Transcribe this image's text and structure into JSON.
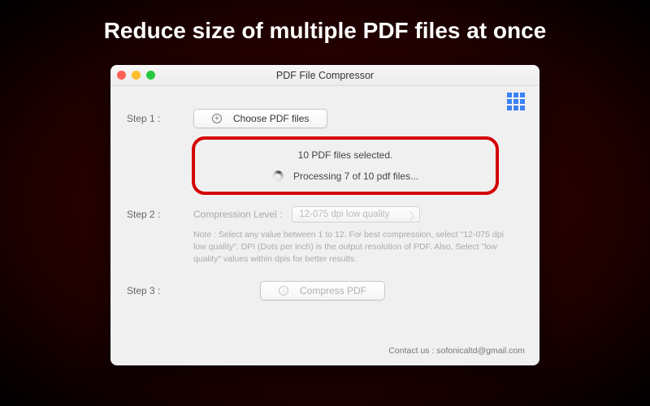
{
  "headline": "Reduce size of multiple PDF files at once",
  "window": {
    "title": "PDF File Compressor"
  },
  "steps": {
    "step1": {
      "label": "Step 1 :",
      "button": "Choose PDF files"
    },
    "step2": {
      "label": "Step 2 :",
      "compression_label": "Compression Level :",
      "selected_option": "12-075 dpi low quality"
    },
    "step3": {
      "label": "Step 3 :",
      "button": "Compress PDF"
    }
  },
  "status": {
    "selected": "10 PDF files selected.",
    "processing": "Processing 7 of 10 pdf files..."
  },
  "note": "Note : Select any value between 1 to 12. For best compression, select \"12-075 dpi low quality\". DPI (Dots per inch) is the output resolution of PDF. Also, Select \"low quality\" values within dpis for better results.",
  "contact": {
    "label": "Contact us :",
    "email": "sofonicaltd@gmail.com"
  }
}
